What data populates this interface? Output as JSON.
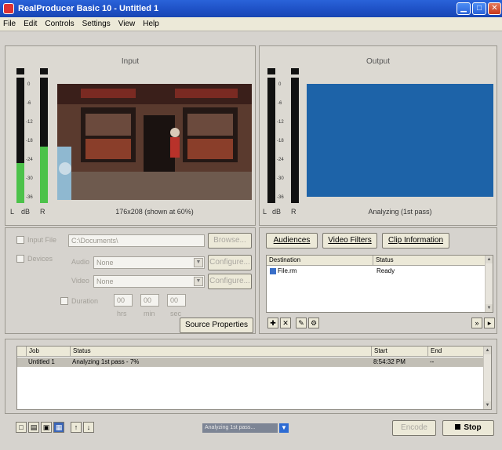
{
  "window": {
    "title": "RealProducer Basic 10 - Untitled 1"
  },
  "menu": [
    "File",
    "Edit",
    "Controls",
    "Settings",
    "View",
    "Help"
  ],
  "input_pane": {
    "title": "Input",
    "caption": "176x208 (shown at 60%)",
    "meter_labels": [
      "L",
      "dB",
      "R"
    ],
    "scale": [
      "0",
      "-6",
      "-12",
      "-18",
      "-24",
      "-30",
      "-36"
    ],
    "left_level": 0.32,
    "right_level": 0.45
  },
  "output_pane": {
    "title": "Output",
    "caption": "Analyzing (1st pass)",
    "meter_labels": [
      "L",
      "dB",
      "R"
    ],
    "scale": [
      "0",
      "-6",
      "-12",
      "-18",
      "-24",
      "-30",
      "-36"
    ],
    "video_color": "#1d63a8"
  },
  "source": {
    "file_label": "Input File",
    "file_value": "C:\\Documents\\",
    "browse_btn": "Browse...",
    "devices_label": "Devices",
    "audio_label": "Audio",
    "audio_value": "None",
    "video_label": "Video",
    "video_value": "None",
    "configure_audio_btn": "Configure...",
    "configure_video_btn": "Configure...",
    "duration_label": "Duration",
    "time_fields": [
      "00",
      "00",
      "00"
    ],
    "time_units": [
      "hrs",
      "min",
      "sec"
    ],
    "source_properties_btn": "Source Properties"
  },
  "tabs": {
    "audiences": "Audiences",
    "video_filters": "Video Filters",
    "clip_information": "Clip Information"
  },
  "destination_table": {
    "headers": [
      "Destination",
      "Status"
    ],
    "rows": [
      {
        "name": "File.rm",
        "status": "Ready"
      }
    ]
  },
  "jobs_table": {
    "headers": [
      "Job",
      "Status",
      "Start",
      "End"
    ],
    "rows": [
      {
        "job": "Untitled 1",
        "status": "Analyzing 1st pass - 7%",
        "start": "8:54:32 PM",
        "end": "--"
      }
    ]
  },
  "bottom": {
    "progress_text": "Analyzing 1st pass...",
    "encode_btn": "Encode",
    "stop_btn": "Stop"
  }
}
